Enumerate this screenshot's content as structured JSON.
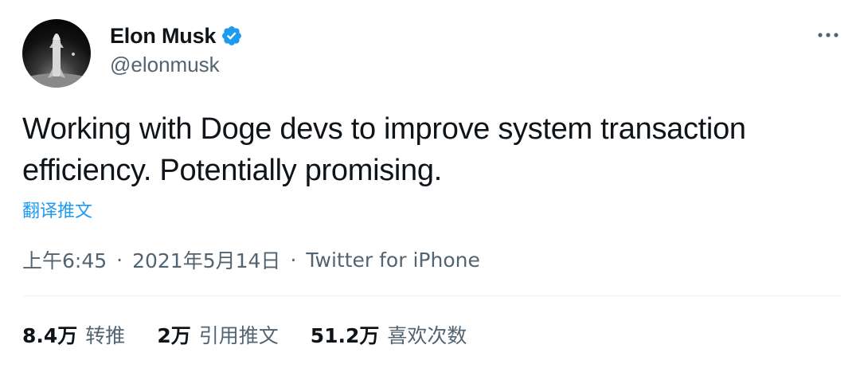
{
  "author": {
    "display_name": "Elon Musk",
    "handle": "@elonmusk",
    "verified_icon": "verified-badge-icon",
    "avatar_icon": "starship-avatar"
  },
  "tweet": {
    "text": "Working with Doge devs to improve system transaction efficiency. Potentially promising.",
    "translate_label": "翻译推文"
  },
  "meta": {
    "time": "上午6:45",
    "separator": "·",
    "date": "2021年5月14日",
    "source": "Twitter for iPhone"
  },
  "stats": {
    "retweets": {
      "count": "8.4万",
      "label": "转推"
    },
    "quotes": {
      "count": "2万",
      "label": "引用推文"
    },
    "likes": {
      "count": "51.2万",
      "label": "喜欢次数"
    }
  },
  "colors": {
    "accent": "#1d9bf0",
    "text": "#0f1419",
    "secondary": "#536471",
    "divider": "#eff3f4"
  }
}
